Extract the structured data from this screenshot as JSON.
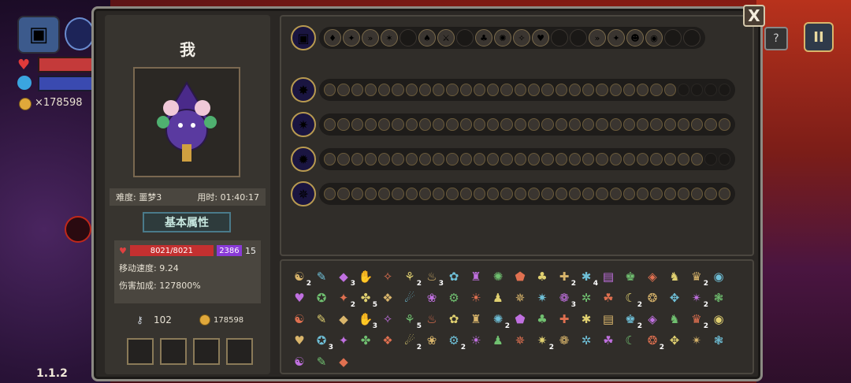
{
  "hud": {
    "gold": "×178598",
    "version": "1.1.2",
    "pause_symbol": "II",
    "help_symbol": "?"
  },
  "panel": {
    "close_symbol": "X",
    "player_name": "我",
    "difficulty": "难度: 噩梦3",
    "time_used": "用时: 01:40:17",
    "attr_title": "基本属性",
    "hp": "8021/8021",
    "mp": "2386",
    "mp_suffix": "15",
    "move_speed": "移动速度: 9.24",
    "damage_bonus": "伤害加成: 127800%",
    "keys": "102",
    "coins": "178598"
  },
  "colors": {
    "accent_gold": "#d9b56b",
    "hp_red": "#c43030",
    "mp_purple": "#8a3ad8"
  },
  "item_badges": [
    "2",
    "",
    "3",
    "",
    "",
    "2",
    "3",
    "",
    "",
    "",
    "",
    "",
    "2",
    "4",
    "",
    "",
    "",
    "",
    "2",
    "",
    "",
    "",
    "2",
    "5",
    "",
    "",
    "",
    "",
    "",
    "",
    "",
    "",
    "3",
    "",
    "",
    "2",
    "",
    "",
    "2",
    "",
    "",
    "",
    "",
    "3",
    "",
    "5",
    "",
    "",
    "",
    "2",
    "",
    "",
    "",
    "",
    "",
    "2",
    "",
    "",
    "2",
    "",
    "",
    "3",
    "",
    "",
    "",
    "2",
    "",
    "2",
    "",
    "",
    "",
    "2",
    "",
    "",
    "",
    "",
    "2",
    "",
    "",
    "",
    "",
    "",
    ""
  ]
}
